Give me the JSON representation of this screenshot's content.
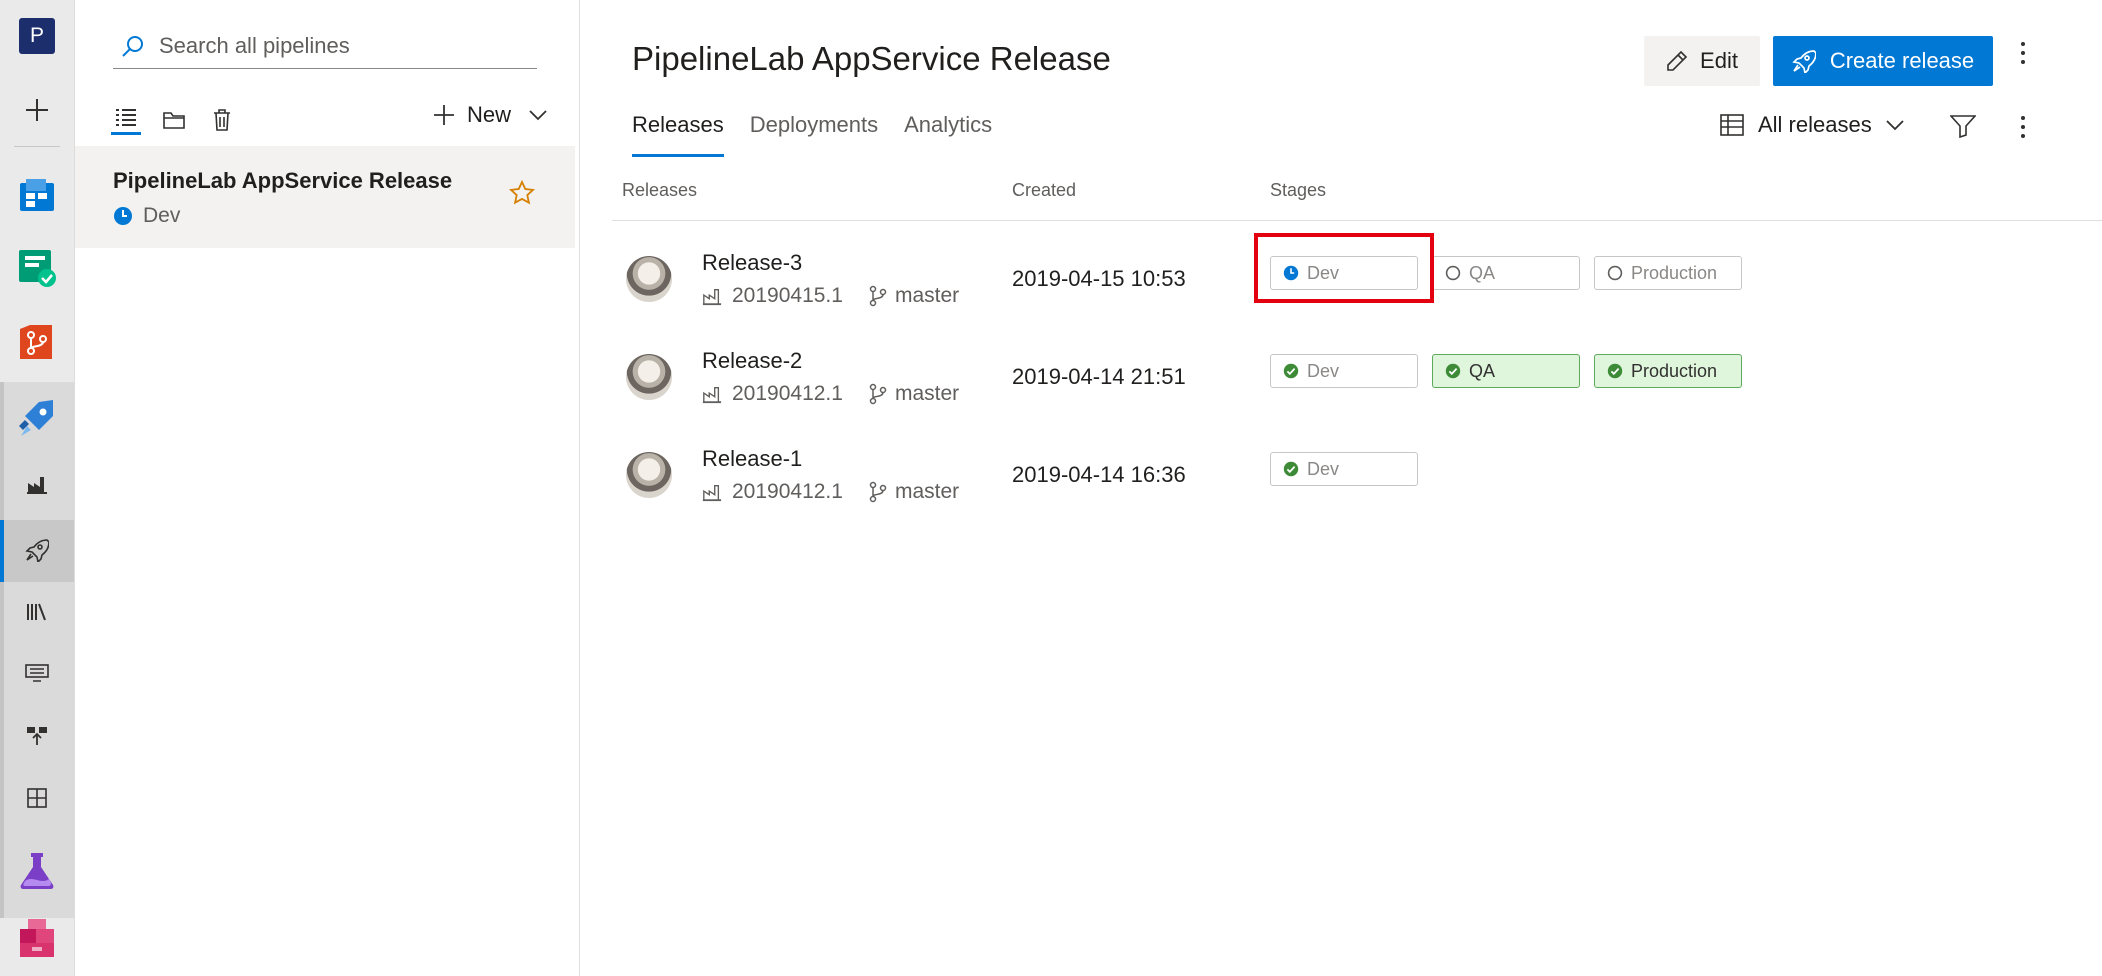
{
  "org": {
    "initial": "P"
  },
  "colors": {
    "accent": "#0078d4",
    "success": "#107c10",
    "highlight": "#e3000f",
    "star": "#d67f00"
  },
  "rail": {
    "icons": [
      "org-icon",
      "add-icon",
      "boards-icon",
      "test-plans-icon",
      "repos-icon",
      "pipelines-icon",
      "builds-icon",
      "releases-icon",
      "library-icon",
      "task-groups-icon",
      "deployment-groups-icon",
      "environments-icon",
      "artifacts-icon",
      "packages-icon"
    ]
  },
  "panel": {
    "search_placeholder": "Search all pipelines",
    "new_label": "New",
    "definitions": [
      {
        "name": "PipelineLab AppService Release",
        "status": "Dev"
      }
    ]
  },
  "header": {
    "title": "PipelineLab AppService Release",
    "edit_label": "Edit",
    "create_label": "Create release"
  },
  "tabs": [
    "Releases",
    "Deployments",
    "Analytics"
  ],
  "view_selector": "All releases",
  "columns": {
    "releases": "Releases",
    "created": "Created",
    "stages": "Stages"
  },
  "releases": [
    {
      "name": "Release-3",
      "build": "20190415.1",
      "branch": "master",
      "created": "2019-04-15 10:53",
      "stages": [
        {
          "name": "Dev",
          "state": "in-progress"
        },
        {
          "name": "QA",
          "state": "not-started"
        },
        {
          "name": "Production",
          "state": "not-started"
        }
      ]
    },
    {
      "name": "Release-2",
      "build": "20190412.1",
      "branch": "master",
      "created": "2019-04-14 21:51",
      "stages": [
        {
          "name": "Dev",
          "state": "succeeded"
        },
        {
          "name": "QA",
          "state": "succeeded"
        },
        {
          "name": "Production",
          "state": "succeeded"
        }
      ]
    },
    {
      "name": "Release-1",
      "build": "20190412.1",
      "branch": "master",
      "created": "2019-04-14 16:36",
      "stages": [
        {
          "name": "Dev",
          "state": "succeeded"
        }
      ]
    }
  ]
}
